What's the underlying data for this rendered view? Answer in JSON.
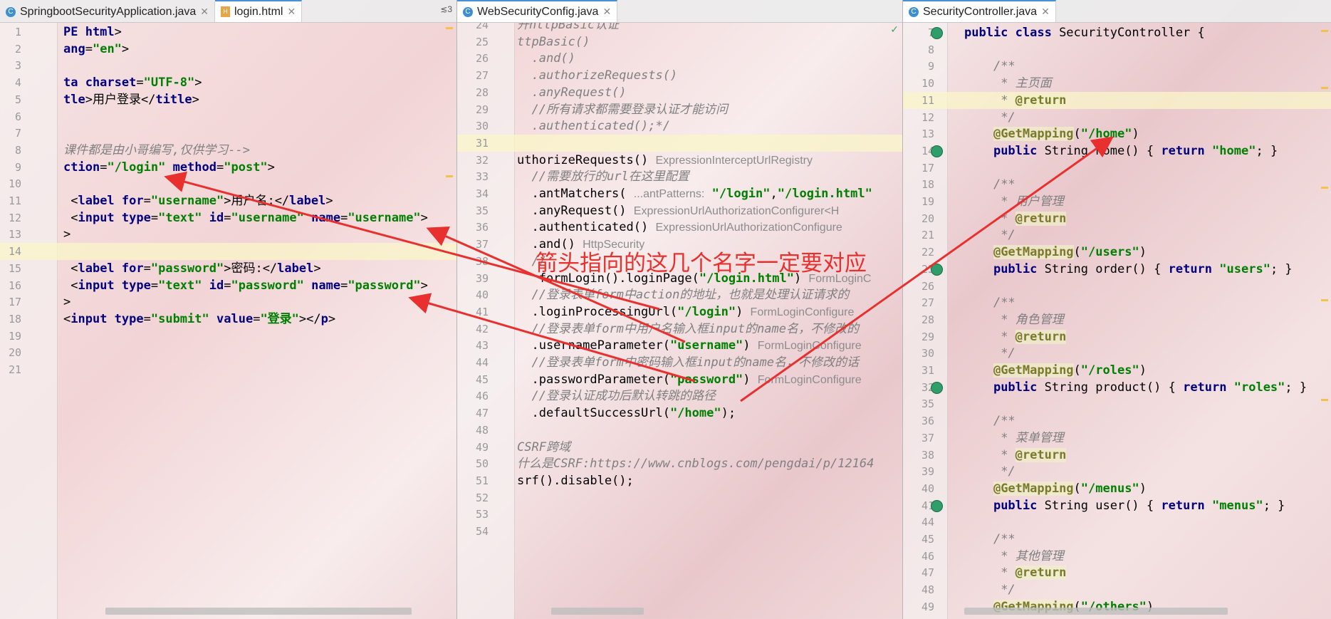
{
  "panes": {
    "left": {
      "tabs": [
        {
          "label": "SpringbootSecurityApplication.java",
          "icon": "java-class-icon",
          "active": false
        },
        {
          "label": "login.html",
          "icon": "html-file-icon",
          "active": true
        }
      ],
      "tab_count": "≲3",
      "lines": [
        {
          "n": "1",
          "html": "<span class=\"kw\">PE html</span>&gt;"
        },
        {
          "n": "2",
          "html": "<span class=\"kw\">ang</span>=<span class=\"str\">\"en\"</span>&gt;"
        },
        {
          "n": "3",
          "html": ""
        },
        {
          "n": "4",
          "html": "<span class=\"kw\">ta charset</span>=<span class=\"str\">\"UTF-8\"</span>&gt;"
        },
        {
          "n": "5",
          "html": "<span class=\"kw\">tle</span>&gt;用户登录&lt;/<span class=\"kw\">title</span>&gt;"
        },
        {
          "n": "6",
          "html": ""
        },
        {
          "n": "7",
          "html": ""
        },
        {
          "n": "8",
          "html": "<span class=\"cm\">课件都是由小哥编写,仅供学习--&gt;</span>"
        },
        {
          "n": "9",
          "html": "<span class=\"kw\">ction</span>=<span class=\"str\">\"/login\"</span> <span class=\"kw\">method</span>=<span class=\"str\">\"post\"</span>&gt;"
        },
        {
          "n": "10",
          "html": ""
        },
        {
          "n": "11",
          "html": " &lt;<span class=\"kw\">label for</span>=<span class=\"str\">\"username\"</span>&gt;用户名:&lt;/<span class=\"kw\">label</span>&gt;"
        },
        {
          "n": "12",
          "html": " &lt;<span class=\"kw\">input type</span>=<span class=\"str\">\"text\"</span> <span class=\"kw\">id</span>=<span class=\"str\">\"username\"</span> <span class=\"kw\">name</span>=<span class=\"str\">\"username\"</span>&gt;"
        },
        {
          "n": "13",
          "html": "&gt;"
        },
        {
          "n": "14",
          "html": "",
          "hl": true
        },
        {
          "n": "15",
          "html": " &lt;<span class=\"kw\">label for</span>=<span class=\"str\">\"password\"</span>&gt;密码:&lt;/<span class=\"kw\">label</span>&gt;"
        },
        {
          "n": "16",
          "html": " &lt;<span class=\"kw\">input type</span>=<span class=\"str\">\"text\"</span> <span class=\"kw\">id</span>=<span class=\"str\">\"password\"</span> <span class=\"kw\">name</span>=<span class=\"str\">\"password\"</span>&gt;"
        },
        {
          "n": "17",
          "html": "&gt;"
        },
        {
          "n": "18",
          "html": "&lt;<span class=\"kw\">input type</span>=<span class=\"str\">\"submit\"</span> <span class=\"kw\">value</span>=<span class=\"str\">\"登录\"</span>&gt;&lt;/<span class=\"kw\">p</span>&gt;"
        },
        {
          "n": "19",
          "html": ""
        },
        {
          "n": "20",
          "html": ""
        },
        {
          "n": "21",
          "html": ""
        }
      ]
    },
    "middle": {
      "tabs": [
        {
          "label": "WebSecurityConfig.java",
          "icon": "java-class-icon",
          "active": true
        }
      ],
      "lines": [
        {
          "n": "24",
          "html": "<span class=\"cm\">开httpBasic认证</span>"
        },
        {
          "n": "25",
          "html": "<span class=\"cm\">ttpBasic()</span>"
        },
        {
          "n": "26",
          "html": "<span class=\"cm\">  .and()</span>"
        },
        {
          "n": "27",
          "html": "<span class=\"cm\">  .authorizeRequests()</span>"
        },
        {
          "n": "28",
          "html": "<span class=\"cm\">  .anyRequest()</span>"
        },
        {
          "n": "29",
          "html": "<span class=\"cm\">  //所有请求都需要登录认证才能访问</span>"
        },
        {
          "n": "30",
          "html": "<span class=\"cm\">  .authenticated();*/</span>"
        },
        {
          "n": "31",
          "html": "",
          "hl": true
        },
        {
          "n": "32",
          "html": "uthorizeRequests() <span class=\"hint\">ExpressionInterceptUrlRegistry</span>"
        },
        {
          "n": "33",
          "html": "  <span class=\"cm\">//需要放行的url在这里配置</span>"
        },
        {
          "n": "34",
          "html": "  .antMatchers( <span class=\"hint\">...antPatterns:</span> <span class=\"str\">\"/login\"</span>,<span class=\"str\">\"/login.html\"</span>"
        },
        {
          "n": "35",
          "html": "  .anyRequest() <span class=\"hint\">ExpressionUrlAuthorizationConfigurer&lt;H</span>"
        },
        {
          "n": "36",
          "html": "  .authenticated() <span class=\"hint\">ExpressionUrlAuthorizationConfigure</span>"
        },
        {
          "n": "37",
          "html": "  .and() <span class=\"hint\">HttpSecurity</span>"
        },
        {
          "n": "38",
          "html": "  <span class=\"cm\">//</span>"
        },
        {
          "n": "39",
          "html": "   formLogin().loginPage(<span class=\"str\">\"/login.html\"</span>) <span class=\"hint\">FormLoginC</span>"
        },
        {
          "n": "40",
          "html": "  <span class=\"cm\">//登录表单form中action的地址，也就是处理认证请求的</span>"
        },
        {
          "n": "41",
          "html": "  .loginProcessingUrl(<span class=\"str\">\"/login\"</span>) <span class=\"hint\">FormLoginConfigure</span>"
        },
        {
          "n": "42",
          "html": "  <span class=\"cm\">//登录表单form中用户名输入框input的name名，不修改的</span>"
        },
        {
          "n": "43",
          "html": "  .usernameParameter(<span class=\"str\">\"username\"</span>) <span class=\"hint\">FormLoginConfigure</span>"
        },
        {
          "n": "44",
          "html": "  <span class=\"cm\">//登录表单form中密码输入框input的name名，不修改的话</span>"
        },
        {
          "n": "45",
          "html": "  .passwordParameter(<span class=\"str\">\"password\"</span>) <span class=\"hint\">FormLoginConfigure</span>"
        },
        {
          "n": "46",
          "html": "  <span class=\"cm\">//登录认证成功后默认转跳的路径</span>"
        },
        {
          "n": "47",
          "html": "  .defaultSuccessUrl(<span class=\"str\">\"/home\"</span>);"
        },
        {
          "n": "48",
          "html": ""
        },
        {
          "n": "49",
          "html": "<span class=\"cm\">CSRF跨域</span>"
        },
        {
          "n": "50",
          "html": "<span class=\"cm\">什么是CSRF:https://www.cnblogs.com/pengdai/p/12164</span>"
        },
        {
          "n": "51",
          "html": "srf().disable();"
        },
        {
          "n": "52",
          "html": ""
        },
        {
          "n": "53",
          "html": ""
        },
        {
          "n": "54",
          "html": ""
        }
      ]
    },
    "right": {
      "tabs": [
        {
          "label": "SecurityController.java",
          "icon": "java-class-icon",
          "active": true
        }
      ],
      "lines": [
        {
          "n": "7",
          "html": "<span class=\"kw\">public class</span> SecurityController {",
          "bean": true
        },
        {
          "n": "8",
          "html": ""
        },
        {
          "n": "9",
          "html": "    <span class=\"cm\">/**</span>"
        },
        {
          "n": "10",
          "html": "    <span class=\"cm\"> * 主页面</span>"
        },
        {
          "n": "11",
          "html": "    <span class=\"cm\"> * </span><span class=\"ann\">@return</span>",
          "hl": true
        },
        {
          "n": "12",
          "html": "    <span class=\"cm\"> */</span>"
        },
        {
          "n": "13",
          "html": "    <span class=\"ann\">@GetMapping</span>(<span class=\"str\">\"/home\"</span>)"
        },
        {
          "n": "14",
          "html": "    <span class=\"kw\">public</span> String home() { <span class=\"kw\">return</span> <span class=\"str\">\"home\"</span>; }",
          "bean": true
        },
        {
          "n": "17",
          "html": ""
        },
        {
          "n": "18",
          "html": "    <span class=\"cm\">/**</span>"
        },
        {
          "n": "19",
          "html": "    <span class=\"cm\"> * 用户管理</span>"
        },
        {
          "n": "20",
          "html": "    <span class=\"cm\"> * </span><span class=\"ann\">@return</span>"
        },
        {
          "n": "21",
          "html": "    <span class=\"cm\"> */</span>"
        },
        {
          "n": "22",
          "html": "    <span class=\"ann\">@GetMapping</span>(<span class=\"str\">\"/users\"</span>)"
        },
        {
          "n": "23",
          "html": "    <span class=\"kw\">public</span> String order() { <span class=\"kw\">return</span> <span class=\"str\">\"users\"</span>; }",
          "bean": true
        },
        {
          "n": "26",
          "html": ""
        },
        {
          "n": "27",
          "html": "    <span class=\"cm\">/**</span>"
        },
        {
          "n": "28",
          "html": "    <span class=\"cm\"> * 角色管理</span>"
        },
        {
          "n": "29",
          "html": "    <span class=\"cm\"> * </span><span class=\"ann\">@return</span>"
        },
        {
          "n": "30",
          "html": "    <span class=\"cm\"> */</span>"
        },
        {
          "n": "31",
          "html": "    <span class=\"ann\">@GetMapping</span>(<span class=\"str\">\"/roles\"</span>)"
        },
        {
          "n": "32",
          "html": "    <span class=\"kw\">public</span> String product() { <span class=\"kw\">return</span> <span class=\"str\">\"roles\"</span>; }",
          "bean": true
        },
        {
          "n": "35",
          "html": ""
        },
        {
          "n": "36",
          "html": "    <span class=\"cm\">/**</span>"
        },
        {
          "n": "37",
          "html": "    <span class=\"cm\"> * 菜单管理</span>"
        },
        {
          "n": "38",
          "html": "    <span class=\"cm\"> * </span><span class=\"ann\">@return</span>"
        },
        {
          "n": "39",
          "html": "    <span class=\"cm\"> */</span>"
        },
        {
          "n": "40",
          "html": "    <span class=\"ann\">@GetMapping</span>(<span class=\"str\">\"/menus\"</span>)"
        },
        {
          "n": "41",
          "html": "    <span class=\"kw\">public</span> String user() { <span class=\"kw\">return</span> <span class=\"str\">\"menus\"</span>; }",
          "bean": true
        },
        {
          "n": "44",
          "html": ""
        },
        {
          "n": "45",
          "html": "    <span class=\"cm\">/**</span>"
        },
        {
          "n": "46",
          "html": "    <span class=\"cm\"> * 其他管理</span>"
        },
        {
          "n": "47",
          "html": "    <span class=\"cm\"> * </span><span class=\"ann\">@return</span>"
        },
        {
          "n": "48",
          "html": "    <span class=\"cm\"> */</span>"
        },
        {
          "n": "49",
          "html": "    <span class=\"ann\">@GetMapping</span>(<span class=\"str\">\"/others\"</span>)"
        }
      ]
    }
  },
  "callout": {
    "text": "箭头指向的这几个名字一定要对应",
    "color": "#e8312e"
  },
  "colors": {
    "keyword": "#000080",
    "string": "#008000",
    "comment": "#808080",
    "annotation": "#7a7a2b",
    "arrow": "#e8312e"
  }
}
